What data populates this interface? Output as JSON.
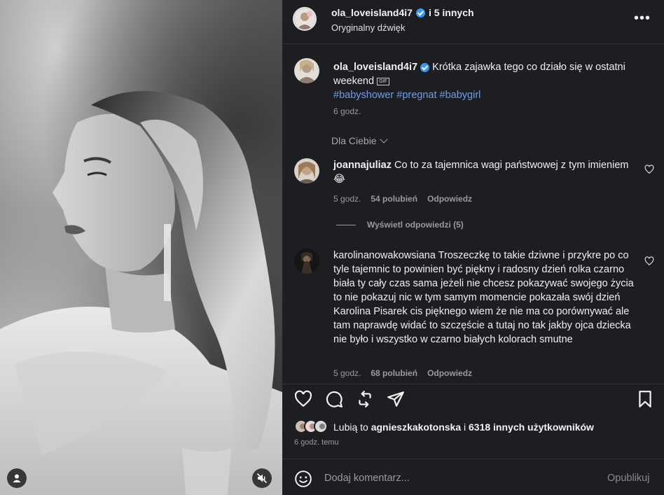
{
  "header": {
    "username": "ola_loveisland4i7",
    "others": "i 5 innych",
    "audio": "Oryginalny dźwięk",
    "more": "•••"
  },
  "caption": {
    "username": "ola_loveisland4i7",
    "text": " Krótka zajawka tego co działo się w ostatni weekend ",
    "gif": "GIF",
    "hashtags": "#babyshower #pregnat #babygirl",
    "time": "6 godz."
  },
  "filter": {
    "label": "Dla Ciebie"
  },
  "comments": [
    {
      "username": "joannajuliaz",
      "text": " Co to za tajemnica wagi państwowej z tym imieniem 😂",
      "time": "5 godz.",
      "likes": "54 polubień",
      "reply": "Odpowiedz"
    },
    {
      "username": "karolinanowakowsiana",
      "text": " Troszeczkę to takie dziwne i przykre po co tyle tajemnic to powinien być piękny i radosny dzień rolka czarno biała ty cały czas sama jeżeli nie chcesz pokazywać swojego życia to nie pokazuj nic w tym samym momencie pokazała swój dzień Karolina Pisarek cis pięknego wiem że nie ma co porównywać ale tam naprawdę widać to szczęście a tutaj no tak jakby ojca dziecka nie było i wszystko w czarno białych kolorach smutne",
      "time": "5 godz.",
      "likes": "68 polubień",
      "reply": "Odpowiedz"
    }
  ],
  "view_replies": "Wyświetl odpowiedzi (5)",
  "likes": {
    "prefix": "Lubią to ",
    "user": "agnieszkakotonska",
    "middle": " i ",
    "count": "6318 innych użytkowników"
  },
  "posted": "6 godz. temu",
  "composer": {
    "placeholder": "Dodaj komentarz...",
    "post": "Opublikuj"
  },
  "icons": {
    "like": "heart-icon",
    "comment": "comment-icon",
    "repost": "repost-icon",
    "share": "send-icon",
    "save": "bookmark-icon",
    "emoji": "emoji-icon",
    "mute": "muted-speaker-icon",
    "tag": "user-tag-icon"
  },
  "colors": {
    "panel_bg": "#1c1e21",
    "hashtag": "#6f9ce8",
    "verified": "#3897f0",
    "muted_text": "#9a9a9a"
  }
}
